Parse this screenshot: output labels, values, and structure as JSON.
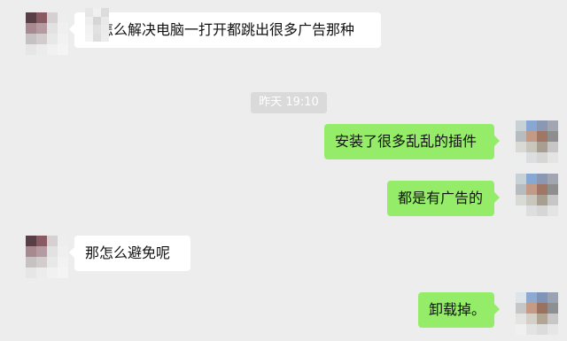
{
  "messages": [
    {
      "side": "left",
      "text": "哥怎么解决电脑一打开都跳出很多广告那种"
    },
    {
      "side": "right",
      "text": "安装了很多乱乱的插件"
    },
    {
      "side": "right",
      "text": "都是有广告的"
    },
    {
      "side": "left",
      "text": "那怎么避免呢"
    },
    {
      "side": "right",
      "text": "卸载掉。"
    }
  ],
  "timestamp": "昨天 19:10",
  "colors": {
    "background": "#ededed",
    "incoming_bubble": "#ffffff",
    "outgoing_bubble": "#95ec69",
    "timestamp_bg": "#dadada"
  },
  "avatars": {
    "contact": [
      "#5a3e45",
      "#8a5a62",
      "#d7d0d2",
      "#eeeeee",
      "#a88990",
      "#b59aa1",
      "#e2e2e2",
      "#f0f0f0",
      "#c6c2c3",
      "#d3cccd",
      "#e8e8e8",
      "#f2f2f2",
      "#e6e6e6",
      "#ececec",
      "#f1f1f1",
      "#f4f4f4"
    ],
    "self": [
      "#c7d1d6",
      "#88a8d4",
      "#8a98b3",
      "#a2a6b0",
      "#b7bcc0",
      "#c39a86",
      "#a07664",
      "#8e8e8e",
      "#d9dad5",
      "#c9c6bd",
      "#a99f90",
      "#c8c6c4",
      "#eceeee",
      "#dcdedf",
      "#d6d6d4",
      "#e4e4e4"
    ],
    "self_bottom": [
      "#dde4ea",
      "#8eaad0",
      "#7f94b6",
      "#9aa3b3",
      "#c4c6c8",
      "#c59b86",
      "#9b7160",
      "#8e8f92",
      "#e3e3e1",
      "#d5d0c7",
      "#b2a594",
      "#c9c7c5",
      "#f0f0f0",
      "#e3e3e3",
      "#dcdcdc",
      "#e6e6e6"
    ]
  }
}
